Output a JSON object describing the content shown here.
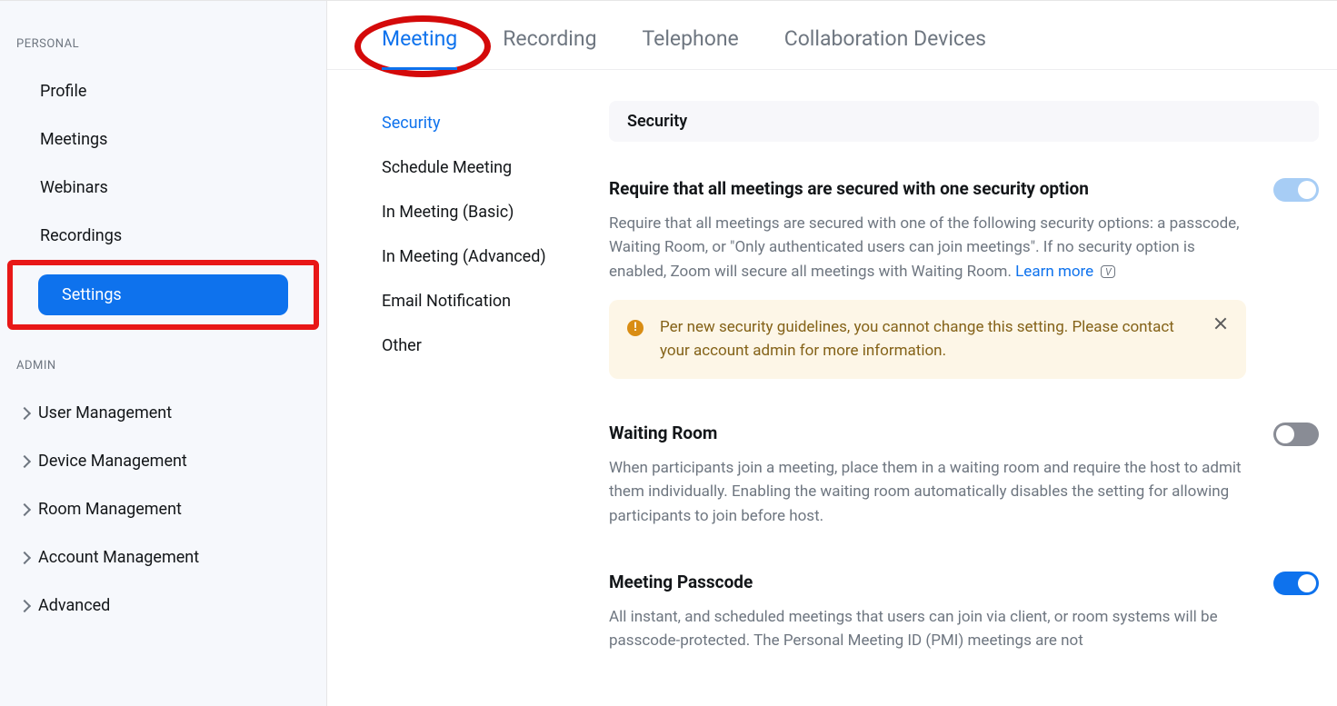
{
  "sidebar": {
    "personal_label": "PERSONAL",
    "admin_label": "ADMIN",
    "items": [
      "Profile",
      "Meetings",
      "Webinars",
      "Recordings",
      "Settings"
    ],
    "active_index": 4,
    "admin_items": [
      "User Management",
      "Device Management",
      "Room Management",
      "Account Management",
      "Advanced"
    ]
  },
  "tabs": {
    "items": [
      "Meeting",
      "Recording",
      "Telephone",
      "Collaboration Devices"
    ],
    "active_index": 0
  },
  "subnav": {
    "items": [
      "Security",
      "Schedule Meeting",
      "In Meeting (Basic)",
      "In Meeting (Advanced)",
      "Email Notification",
      "Other"
    ],
    "active_index": 0
  },
  "section_header": "Security",
  "settings": [
    {
      "title": "Require that all meetings are secured with one security option",
      "desc": "Require that all meetings are secured with one of the following security options: a passcode, Waiting Room, or \"Only authenticated users can join meetings\". If no security option is enabled, Zoom will secure all meetings with Waiting Room. ",
      "link": "Learn more",
      "badge": "V",
      "toggle": "on-locked",
      "notice": "Per new security guidelines, you cannot change this setting. Please contact your account admin for more information."
    },
    {
      "title": "Waiting Room",
      "desc": "When participants join a meeting, place them in a waiting room and require the host to admit them individually. Enabling the waiting room automatically disables the setting for allowing participants to join before host.",
      "toggle": "off"
    },
    {
      "title": "Meeting Passcode",
      "desc": "All instant, and scheduled meetings that users can join via client, or room systems will be passcode-protected. The Personal Meeting ID (PMI) meetings are not",
      "toggle": "on"
    }
  ]
}
